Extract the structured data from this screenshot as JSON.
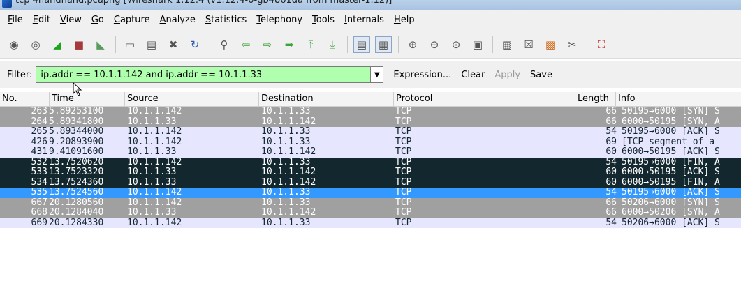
{
  "window": {
    "title": "tcp 4handhand.pcapng   [Wireshark 1.12.4  (v1.12.4-0-gb4861da from master-1.12)]"
  },
  "menu": [
    {
      "label": "File"
    },
    {
      "label": "Edit"
    },
    {
      "label": "View"
    },
    {
      "label": "Go"
    },
    {
      "label": "Capture"
    },
    {
      "label": "Analyze"
    },
    {
      "label": "Statistics"
    },
    {
      "label": "Telephony"
    },
    {
      "label": "Tools"
    },
    {
      "label": "Internals"
    },
    {
      "label": "Help"
    }
  ],
  "toolbar": {
    "icons": [
      "interface-list-icon",
      "capture-options-icon",
      "start-capture-icon",
      "stop-capture-icon",
      "restart-capture-icon",
      "|",
      "open-file-icon",
      "save-file-icon",
      "close-file-icon",
      "reload-icon",
      "|",
      "find-packet-icon",
      "go-back-icon",
      "go-forward-icon",
      "go-to-packet-icon",
      "go-first-icon",
      "go-last-icon",
      "|",
      "colorize-icon",
      "auto-scroll-icon",
      "|",
      "zoom-in-icon",
      "zoom-out-icon",
      "zoom-normal-icon",
      "resize-columns-icon",
      "|",
      "capture-filters-icon",
      "display-filters-icon",
      "coloring-rules-icon",
      "preferences-icon",
      "|",
      "help-icon"
    ]
  },
  "filter": {
    "label": "Filter:",
    "value": "ip.addr == 10.1.1.142 and ip.addr == 10.1.1.33",
    "expression_label": "Expression...",
    "clear_label": "Clear",
    "apply_label": "Apply",
    "save_label": "Save",
    "accent_color": "#afffaf"
  },
  "packet_list": {
    "columns": [
      "No.",
      "Time",
      "Source",
      "Destination",
      "Protocol",
      "Length",
      "Info"
    ],
    "rows": [
      {
        "no": "263",
        "time": "5.89253100",
        "src": "10.1.1.142",
        "dst": "10.1.1.33",
        "proto": "TCP",
        "len": "66",
        "info": "50195→6000  [SYN] S",
        "bg": "#a0a0a0",
        "fg": "#ffffff"
      },
      {
        "no": "264",
        "time": "5.89341800",
        "src": "10.1.1.33",
        "dst": "10.1.1.142",
        "proto": "TCP",
        "len": "66",
        "info": "6000→50195  [SYN, A",
        "bg": "#a0a0a0",
        "fg": "#ffffff"
      },
      {
        "no": "265",
        "time": "5.89344000",
        "src": "10.1.1.142",
        "dst": "10.1.1.33",
        "proto": "TCP",
        "len": "54",
        "info": "50195→6000  [ACK] S",
        "bg": "#e7e6ff",
        "fg": "#12272e"
      },
      {
        "no": "426",
        "time": "9.20893900",
        "src": "10.1.1.142",
        "dst": "10.1.1.33",
        "proto": "TCP",
        "len": "69",
        "info": "[TCP segment of a",
        "bg": "#e7e6ff",
        "fg": "#12272e"
      },
      {
        "no": "431",
        "time": "9.41091600",
        "src": "10.1.1.33",
        "dst": "10.1.1.142",
        "proto": "TCP",
        "len": "60",
        "info": "6000→50195  [ACK] S",
        "bg": "#e7e6ff",
        "fg": "#12272e"
      },
      {
        "no": "532",
        "time": "13.7520620",
        "src": "10.1.1.142",
        "dst": "10.1.1.33",
        "proto": "TCP",
        "len": "54",
        "info": "50195→6000  [FIN, A",
        "bg": "#12272e",
        "fg": "#ffffff"
      },
      {
        "no": "533",
        "time": "13.7523320",
        "src": "10.1.1.33",
        "dst": "10.1.1.142",
        "proto": "TCP",
        "len": "60",
        "info": "6000→50195  [ACK] S",
        "bg": "#12272e",
        "fg": "#ffffff"
      },
      {
        "no": "534",
        "time": "13.7524360",
        "src": "10.1.1.33",
        "dst": "10.1.1.142",
        "proto": "TCP",
        "len": "60",
        "info": "6000→50195  [FIN, A",
        "bg": "#12272e",
        "fg": "#ffffff"
      },
      {
        "no": "535",
        "time": "13.7524560",
        "src": "10.1.1.142",
        "dst": "10.1.1.33",
        "proto": "TCP",
        "len": "54",
        "info": "50195→6000  [ACK] S",
        "bg": "#3399ff",
        "fg": "#ffffff"
      },
      {
        "no": "667",
        "time": "20.1280560",
        "src": "10.1.1.142",
        "dst": "10.1.1.33",
        "proto": "TCP",
        "len": "66",
        "info": "50206→6000  [SYN] S",
        "bg": "#a0a0a0",
        "fg": "#ffffff"
      },
      {
        "no": "668",
        "time": "20.1284040",
        "src": "10.1.1.33",
        "dst": "10.1.1.142",
        "proto": "TCP",
        "len": "66",
        "info": "6000→50206  [SYN, A",
        "bg": "#a0a0a0",
        "fg": "#ffffff"
      },
      {
        "no": "669",
        "time": "20.1284330",
        "src": "10.1.1.142",
        "dst": "10.1.1.33",
        "proto": "TCP",
        "len": "54",
        "info": "50206→6000  [ACK] S",
        "bg": "#e7e6ff",
        "fg": "#12272e"
      }
    ]
  }
}
